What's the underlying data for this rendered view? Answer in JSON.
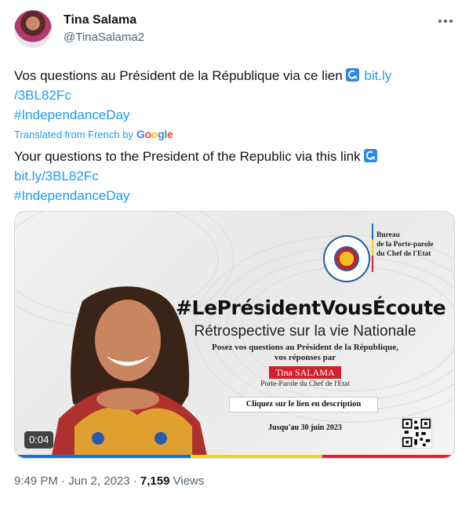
{
  "author": {
    "name": "Tina Salama",
    "handle": "@TinaSalama2"
  },
  "original": {
    "text": "Vos questions au Président de la République via ce lien ",
    "link_part1": "bit.ly",
    "link_part2": "/3BL82Fc",
    "hashtag": "#IndependanceDay"
  },
  "translation": {
    "label": "Translated from French by",
    "google": [
      "G",
      "o",
      "o",
      "g",
      "l",
      "e"
    ],
    "text": "Your questions to the President of the Republic via this link ",
    "link": "bit.ly/3BL82Fc",
    "hashtag": "#IndependanceDay"
  },
  "media": {
    "bureau_lines": [
      "Bureau",
      "de la Porte-parole",
      "du Chef de l'Etat"
    ],
    "hashtag": "#LePrésidentVousÉcoute",
    "subtitle": "Rétrospective sur la vie Nationale",
    "ask_line1": "Posez vos questions au Président de la République,",
    "ask_line2": "vos réponses par",
    "name_badge": "Tina SALAMA",
    "role": "Porte-Parole du Chef de l'Etat",
    "cta": "Cliquez sur le lien en description",
    "deadline": "Jusqu'au 30 juin 2023",
    "duration": "0:04"
  },
  "meta": {
    "time_date": "9:49 PM · Jun 2, 2023 · ",
    "views_count": "7,159",
    "views_label": " Views"
  },
  "colors": {
    "link": "#1d9bf0",
    "secondary": "#536471",
    "badge_red": "#d0222a"
  },
  "icons": [
    "more-icon",
    "arrow-link-icon",
    "google-logo",
    "seal-icon",
    "qr-code-icon"
  ]
}
